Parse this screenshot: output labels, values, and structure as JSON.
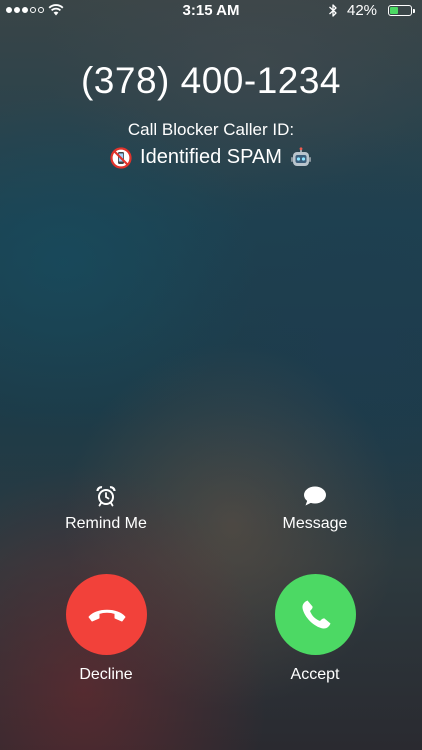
{
  "status_bar": {
    "signal_dots_total": 5,
    "signal_dots_filled": 3,
    "time": "3:15 AM",
    "battery_percent_label": "42%",
    "battery_level": 0.42,
    "battery_color": "#4cd964"
  },
  "call": {
    "number": "(378) 400-1234",
    "caller_id_label": "Call Blocker Caller ID:",
    "status_text": "Identified SPAM",
    "status_icon_left": "no-phone-icon",
    "status_icon_right": "robot-icon"
  },
  "actions": {
    "remind": {
      "label": "Remind Me",
      "icon": "alarm-clock-icon"
    },
    "message": {
      "label": "Message",
      "icon": "speech-bubble-icon"
    }
  },
  "buttons": {
    "decline": {
      "label": "Decline",
      "color": "#f2413a",
      "icon": "phone-down-icon"
    },
    "accept": {
      "label": "Accept",
      "color": "#4cd964",
      "icon": "phone-icon"
    }
  }
}
